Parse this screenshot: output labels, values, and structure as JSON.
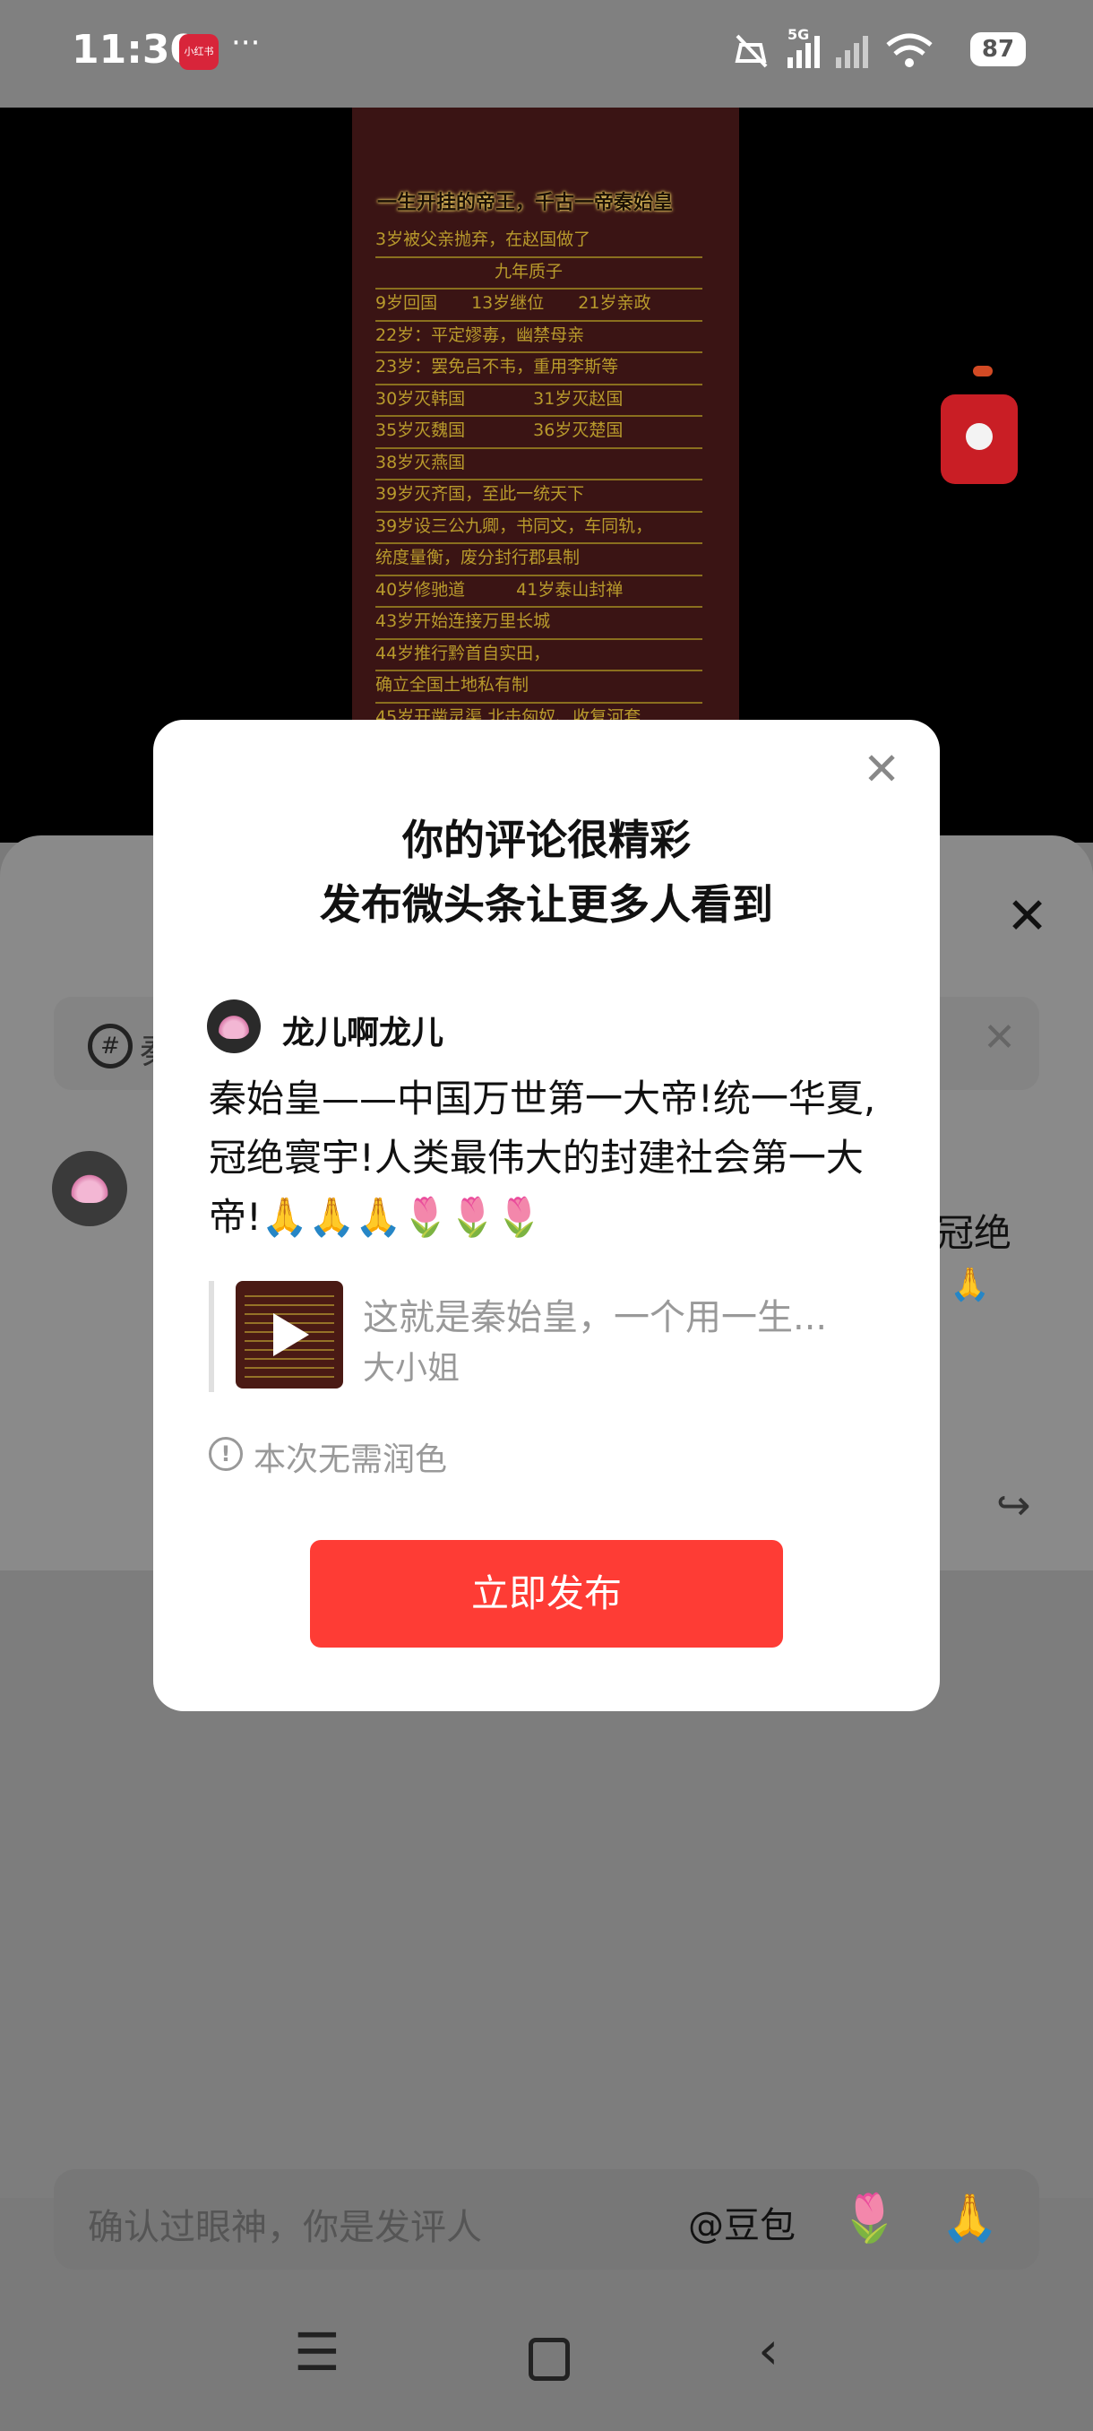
{
  "status_bar": {
    "time": "11:30",
    "app_badge": "小红书",
    "more": "···",
    "network": "5G",
    "battery": "87"
  },
  "video": {
    "poster_title": "一生开挂的帝王，千古一帝秦始皇",
    "poster_lines": [
      "3岁被父亲抛弃，在赵国做了",
      "　　　　　　　九年质子",
      "9岁回国　　13岁继位　　21岁亲政",
      "22岁：平定嫪毐，幽禁母亲",
      "23岁：罢免吕不韦，重用李斯等",
      "30岁灭韩国　　　　31岁灭赵国",
      "35岁灭魏国　　　　36岁灭楚国",
      "38岁灭燕国",
      "39岁灭齐国，至此一统天下",
      "39岁设三公九卿，书同文，车同轨，",
      "统度量衡，废分封行郡县制",
      "40岁修驰道　　　41岁泰山封禅",
      "43岁开始连接万里长城",
      "44岁推行黔首自实田，",
      "确立全国土地私有制",
      "45岁开凿灵渠 北击匈奴、收复河套"
    ]
  },
  "sheet": {
    "topic_icon": "#",
    "topic_text": "秦",
    "comment_fragment": "冠绝",
    "comment_fragment2": "🙏"
  },
  "dialog": {
    "title_line1": "你的评论很精彩",
    "title_line2": "发布微头条让更多人看到",
    "user_name": "龙儿啊龙儿",
    "comment": "秦始皇——中国万世第一大帝!统一华夏,冠绝寰宇!人类最伟大的封建社会第一大帝!🙏🙏🙏🌷🌷🌷",
    "quote_title": "这就是秦始皇，一个用一生...",
    "quote_author": "大小姐",
    "info_text": "本次无需润色",
    "publish_label": "立即发布"
  },
  "input_bar": {
    "placeholder": "确认过眼神，你是发评人",
    "mention": "@豆包",
    "rose": "🌷",
    "pray": "🙏"
  },
  "icons": {
    "close": "✕",
    "share": "↪",
    "menu": "☰",
    "back": "‹",
    "info": "!"
  },
  "colors": {
    "publish_button": "#fe3c35",
    "overlay": "#7a7a7a"
  }
}
